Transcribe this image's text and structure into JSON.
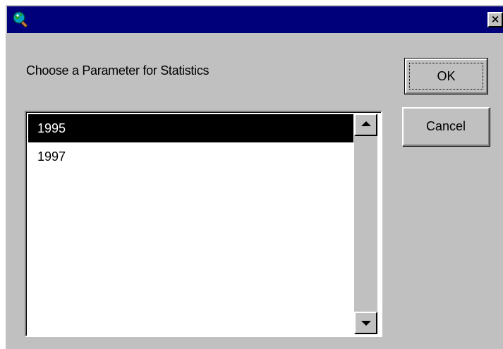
{
  "window": {
    "icon": "globe-magnifier-icon",
    "close_label": "×"
  },
  "dialog": {
    "prompt": "Choose a Parameter for Statistics",
    "ok_label": "OK",
    "cancel_label": "Cancel"
  },
  "list": {
    "items": [
      "1995",
      "1997"
    ],
    "selected": "1995"
  },
  "colors": {
    "titlebar": "#00007b",
    "face": "#c0c0c0",
    "selection": "#000000"
  }
}
